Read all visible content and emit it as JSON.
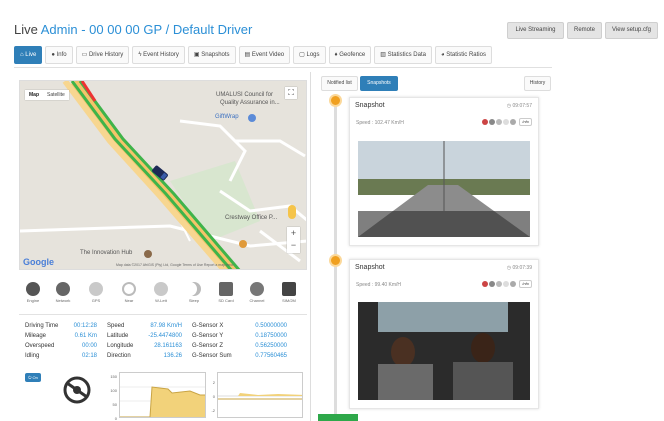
{
  "header": {
    "title_prefix": "Live",
    "title_driver": "Admin - 00 00 00 GP",
    "title_sep": "/",
    "title_driver2": "Default Driver"
  },
  "top_buttons": [
    "Live Streaming",
    "Remote",
    "View setup.cfg"
  ],
  "tabs": [
    "Live",
    "Info",
    "Drive History",
    "Event History",
    "Snapshots",
    "Event Video",
    "Logs",
    "Geofence",
    "Statistics Data",
    "Statistic Ratios"
  ],
  "map": {
    "type_map": "Map",
    "type_satellite": "Satellite",
    "labels": {
      "umalusi": "UMALUSI Council for",
      "quality": "Quality Assurance in...",
      "giftwrap": "GiftWrap",
      "crestway": "Crestway Office P...",
      "innovation": "The Innovation Hub",
      "google": "Google",
      "footer": "Map data ©2017 AfriGIS (Pty) Ltd, Google   Terms of Use   Report a map error"
    }
  },
  "sensors": [
    {
      "label": "Engine",
      "icon": "engine-icon"
    },
    {
      "label": "Network",
      "icon": "network-icon"
    },
    {
      "label": "GPS",
      "icon": "gps-icon"
    },
    {
      "label": "Near",
      "icon": "near-icon"
    },
    {
      "label": "W-Lett",
      "icon": "wlett-icon"
    },
    {
      "label": "Sleep",
      "icon": "sleep-icon"
    },
    {
      "label": "SD Card",
      "icon": "sdcard-icon"
    },
    {
      "label": "Channel",
      "icon": "channel-icon"
    },
    {
      "label": "SIM/2M",
      "icon": "sim-icon"
    }
  ],
  "stats": [
    {
      "l1": "Driving Time",
      "v1": "00:12:28",
      "l2": "Speed",
      "v2": "87.98 Km/H",
      "l3": "G-Sensor X",
      "v3": "0.50000000"
    },
    {
      "l1": "Mileage",
      "v1": "0.61 Km",
      "l2": "Latitude",
      "v2": "-25.4474800",
      "l3": "G-Sensor Y",
      "v3": "0.18750000"
    },
    {
      "l1": "Overspeed",
      "v1": "00:00",
      "l2": "Longitude",
      "v2": "28.161163",
      "l3": "G-Sensor Z",
      "v3": "0.56250000"
    },
    {
      "l1": "Idling",
      "v1": "02:18",
      "l2": "Direction",
      "v2": "136.26",
      "l3": "G-Sensor Sum",
      "v3": "0.77560465"
    }
  ],
  "on_button": "On",
  "speed_chart": {
    "ticks": [
      "150",
      "100",
      "50",
      "0"
    ]
  },
  "g_chart": {
    "ticks": [
      "2",
      "0",
      "-2"
    ]
  },
  "side": {
    "notified_list": "Notified list",
    "snapshots": "Snapshots",
    "history": "History"
  },
  "snapshots": [
    {
      "title": "Snapshot",
      "time": "09:07:57",
      "speed": "Speed : 102.47 Km/H",
      "info": "Info"
    },
    {
      "title": "Snapshot",
      "time": "09:07:39",
      "speed": "Speed : 99.40 Km/H",
      "info": "Info"
    }
  ],
  "colors": {
    "accent": "#2f7fb8",
    "title_blue": "#2b8fd6",
    "timeline_dot": "#f0a020",
    "green": "#2ea84a",
    "chart_fill": "#f2d27a"
  }
}
